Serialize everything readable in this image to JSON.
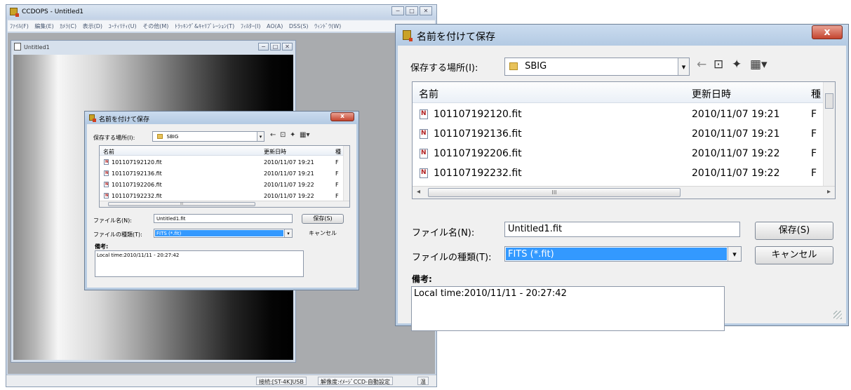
{
  "app": {
    "title": "CCDOPS - Untitled1",
    "menu": [
      "ﾌｧｲﾙ(F)",
      "編集(E)",
      "ｶﾒﾗ(C)",
      "表示(D)",
      "ﾕｰﾃｨﾘﾃｨ(U)",
      "その他(M)",
      "ﾄﾗｯｷﾝｸﾞ&ｷｬﾘﾌﾞﾚｰｼｮﾝ(T)",
      "ﾌｨﾙﾀｰ(I)",
      "AO(A)",
      "DSS(S)",
      "ｳｨﾝﾄﾞｳ(W)"
    ],
    "child_title": "Untitled1",
    "status": {
      "connection": "接続:[ST-4K]USB",
      "resolution": "解像度:ｲﾒｰｼﾞCCD-自動設定",
      "extra": "温"
    }
  },
  "dialog": {
    "title": "名前を付けて保存",
    "location_label": "保存する場所(I):",
    "location_value": "SBIG",
    "col_name": "名前",
    "col_date": "更新日時",
    "col_type": "種",
    "files": [
      {
        "name": "101107192120.fit",
        "date": "2010/11/07 19:21",
        "type": "F"
      },
      {
        "name": "101107192136.fit",
        "date": "2010/11/07 19:21",
        "type": "F"
      },
      {
        "name": "101107192206.fit",
        "date": "2010/11/07 19:22",
        "type": "F"
      },
      {
        "name": "101107192232.fit",
        "date": "2010/11/07 19:22",
        "type": "F"
      }
    ],
    "filename_label": "ファイル名(N):",
    "filename_value": "Untitled1.fit",
    "filetype_label": "ファイルの種類(T):",
    "filetype_value": "FITS (*.fit)",
    "save_button": "保存(S)",
    "cancel_button": "キャンセル",
    "memo_label": "備考:",
    "memo_value": "Local time:2010/11/11 - 20:27:42",
    "scroll_grip": "III"
  },
  "icons": {
    "close": "close-icon",
    "back": "back-arrow-icon",
    "up": "up-folder-icon",
    "new_folder": "new-folder-icon",
    "view": "view-menu-icon"
  },
  "colors": {
    "selection": "#3399ff",
    "title_gradient": "#b3cae3",
    "close": "#c4442e"
  }
}
